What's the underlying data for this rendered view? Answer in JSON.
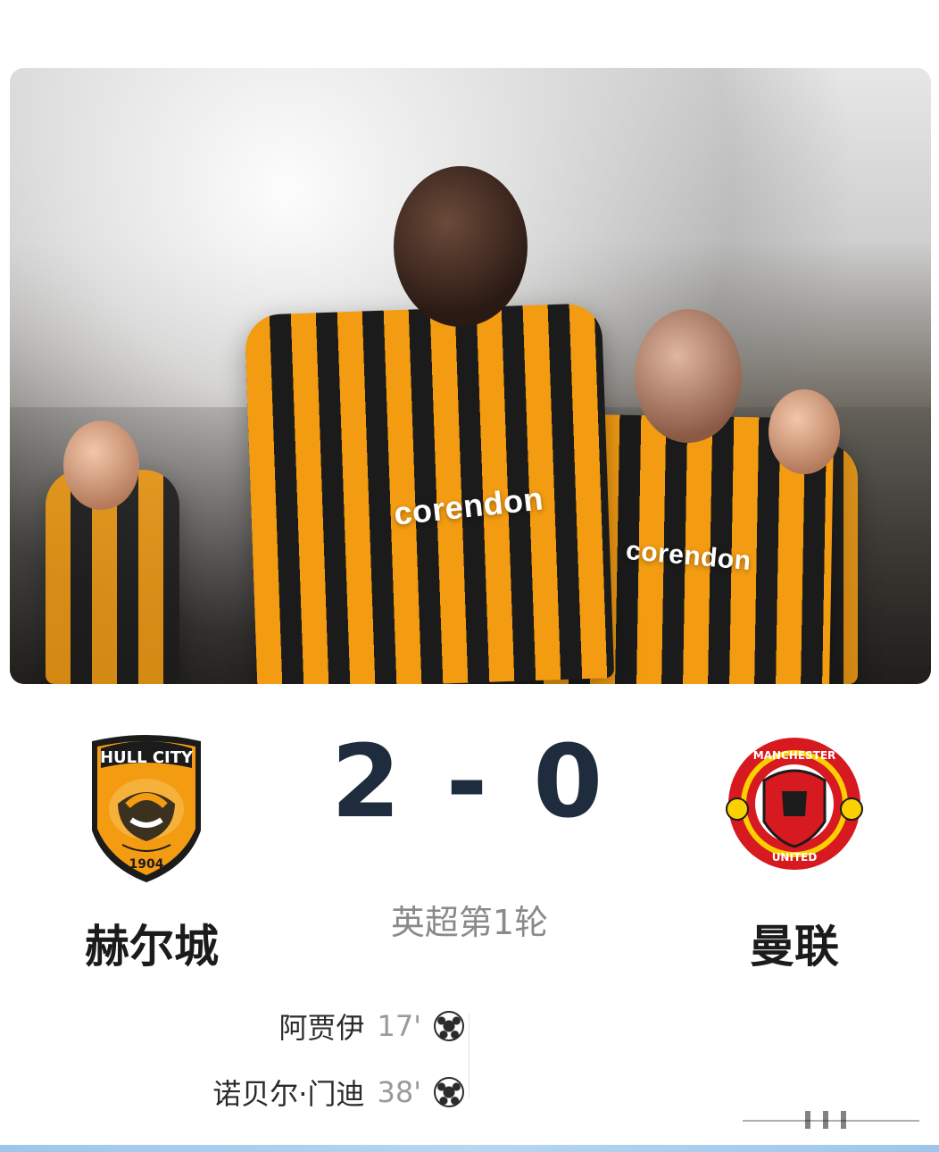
{
  "hero": {
    "sponsor_text": "corendon",
    "colors": {
      "kit_orange": "#f39c12",
      "kit_black": "#1b1b1b"
    }
  },
  "match": {
    "score_display": "2 - 0",
    "round": "英超第1轮",
    "home_team": "赫尔城",
    "away_team": "曼联"
  },
  "crests": {
    "home_text_top": "HULL CITY",
    "home_text_bottom": "1904",
    "away_text_top": "MANCHESTER",
    "away_text_bottom": "UNITED"
  },
  "goals": [
    {
      "scorer": "阿贾伊",
      "minute": "17'"
    },
    {
      "scorer": "诺贝尔·门迪",
      "minute": "38'"
    }
  ],
  "icons": {
    "goal": "soccer-ball-icon",
    "more": "more-icon"
  },
  "colors": {
    "score_text": "#1e2c3e",
    "muted_text": "#8a8a8a",
    "bottom_bar": "#9ec6ea"
  }
}
